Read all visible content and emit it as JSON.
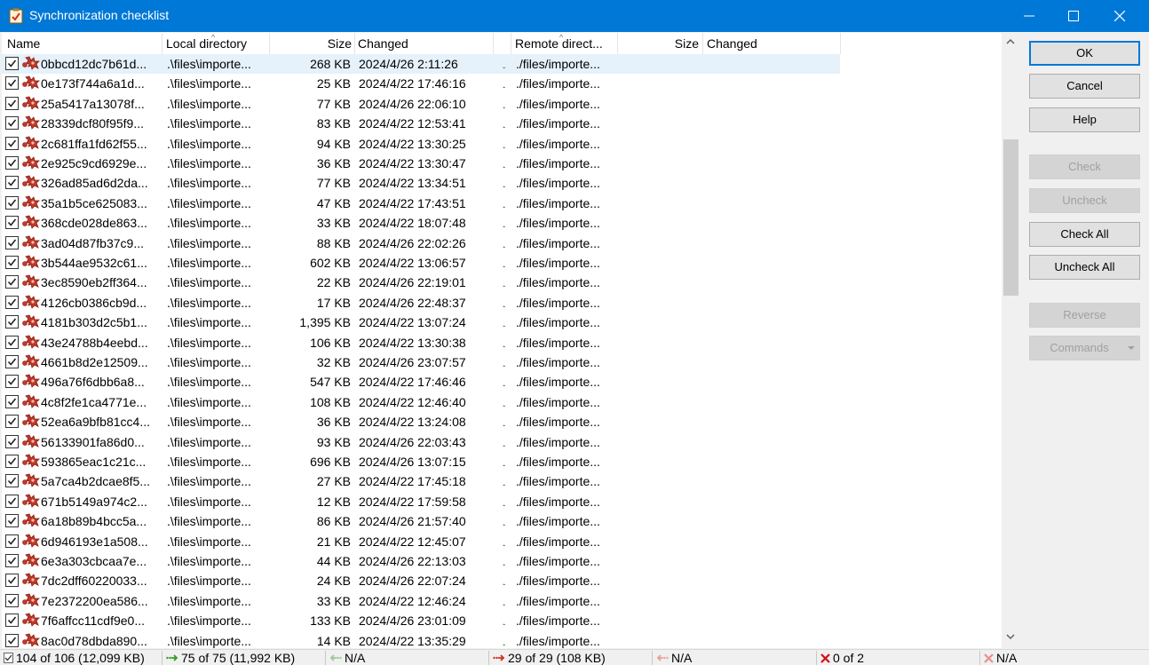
{
  "window": {
    "title": "Synchronization checklist",
    "icon": "checklist-icon"
  },
  "columns": {
    "name": "Name",
    "local_directory": "Local directory",
    "size": "Size",
    "changed": "Changed",
    "remote_directory": "Remote direct...",
    "remote_size": "Size",
    "remote_changed": "Changed"
  },
  "rows": [
    {
      "name": "0bbcd12dc7b61d...",
      "ldir": ".\\files\\importe...",
      "size": "268 KB",
      "changed": "2024/4/26 2:11:26",
      "rdir": "./files/importe..."
    },
    {
      "name": "0e173f744a6a1d...",
      "ldir": ".\\files\\importe...",
      "size": "25 KB",
      "changed": "2024/4/22 17:46:16",
      "rdir": "./files/importe..."
    },
    {
      "name": "25a5417a13078f...",
      "ldir": ".\\files\\importe...",
      "size": "77 KB",
      "changed": "2024/4/26 22:06:10",
      "rdir": "./files/importe..."
    },
    {
      "name": "28339dcf80f95f9...",
      "ldir": ".\\files\\importe...",
      "size": "83 KB",
      "changed": "2024/4/22 12:53:41",
      "rdir": "./files/importe..."
    },
    {
      "name": "2c681ffa1fd62f55...",
      "ldir": ".\\files\\importe...",
      "size": "94 KB",
      "changed": "2024/4/22 13:30:25",
      "rdir": "./files/importe..."
    },
    {
      "name": "2e925c9cd6929e...",
      "ldir": ".\\files\\importe...",
      "size": "36 KB",
      "changed": "2024/4/22 13:30:47",
      "rdir": "./files/importe..."
    },
    {
      "name": "326ad85ad6d2da...",
      "ldir": ".\\files\\importe...",
      "size": "77 KB",
      "changed": "2024/4/22 13:34:51",
      "rdir": "./files/importe..."
    },
    {
      "name": "35a1b5ce625083...",
      "ldir": ".\\files\\importe...",
      "size": "47 KB",
      "changed": "2024/4/22 17:43:51",
      "rdir": "./files/importe..."
    },
    {
      "name": "368cde028de863...",
      "ldir": ".\\files\\importe...",
      "size": "33 KB",
      "changed": "2024/4/22 18:07:48",
      "rdir": "./files/importe..."
    },
    {
      "name": "3ad04d87fb37c9...",
      "ldir": ".\\files\\importe...",
      "size": "88 KB",
      "changed": "2024/4/26 22:02:26",
      "rdir": "./files/importe..."
    },
    {
      "name": "3b544ae9532c61...",
      "ldir": ".\\files\\importe...",
      "size": "602 KB",
      "changed": "2024/4/22 13:06:57",
      "rdir": "./files/importe..."
    },
    {
      "name": "3ec8590eb2ff364...",
      "ldir": ".\\files\\importe...",
      "size": "22 KB",
      "changed": "2024/4/26 22:19:01",
      "rdir": "./files/importe..."
    },
    {
      "name": "4126cb0386cb9d...",
      "ldir": ".\\files\\importe...",
      "size": "17 KB",
      "changed": "2024/4/26 22:48:37",
      "rdir": "./files/importe..."
    },
    {
      "name": "4181b303d2c5b1...",
      "ldir": ".\\files\\importe...",
      "size": "1,395 KB",
      "changed": "2024/4/22 13:07:24",
      "rdir": "./files/importe..."
    },
    {
      "name": "43e24788b4eebd...",
      "ldir": ".\\files\\importe...",
      "size": "106 KB",
      "changed": "2024/4/22 13:30:38",
      "rdir": "./files/importe..."
    },
    {
      "name": "4661b8d2e12509...",
      "ldir": ".\\files\\importe...",
      "size": "32 KB",
      "changed": "2024/4/26 23:07:57",
      "rdir": "./files/importe..."
    },
    {
      "name": "496a76f6dbb6a8...",
      "ldir": ".\\files\\importe...",
      "size": "547 KB",
      "changed": "2024/4/22 17:46:46",
      "rdir": "./files/importe..."
    },
    {
      "name": "4c8f2fe1ca4771e...",
      "ldir": ".\\files\\importe...",
      "size": "108 KB",
      "changed": "2024/4/22 12:46:40",
      "rdir": "./files/importe..."
    },
    {
      "name": "52ea6a9bfb81cc4...",
      "ldir": ".\\files\\importe...",
      "size": "36 KB",
      "changed": "2024/4/22 13:24:08",
      "rdir": "./files/importe..."
    },
    {
      "name": "56133901fa86d0...",
      "ldir": ".\\files\\importe...",
      "size": "93 KB",
      "changed": "2024/4/26 22:03:43",
      "rdir": "./files/importe..."
    },
    {
      "name": "593865eac1c21c...",
      "ldir": ".\\files\\importe...",
      "size": "696 KB",
      "changed": "2024/4/26 13:07:15",
      "rdir": "./files/importe..."
    },
    {
      "name": "5a7ca4b2dcae8f5...",
      "ldir": ".\\files\\importe...",
      "size": "27 KB",
      "changed": "2024/4/22 17:45:18",
      "rdir": "./files/importe..."
    },
    {
      "name": "671b5149a974c2...",
      "ldir": ".\\files\\importe...",
      "size": "12 KB",
      "changed": "2024/4/22 17:59:58",
      "rdir": "./files/importe..."
    },
    {
      "name": "6a18b89b4bcc5a...",
      "ldir": ".\\files\\importe...",
      "size": "86 KB",
      "changed": "2024/4/26 21:57:40",
      "rdir": "./files/importe..."
    },
    {
      "name": "6d946193e1a508...",
      "ldir": ".\\files\\importe...",
      "size": "21 KB",
      "changed": "2024/4/22 12:45:07",
      "rdir": "./files/importe..."
    },
    {
      "name": "6e3a303cbcaa7e...",
      "ldir": ".\\files\\importe...",
      "size": "44 KB",
      "changed": "2024/4/26 22:13:03",
      "rdir": "./files/importe..."
    },
    {
      "name": "7dc2dff60220033...",
      "ldir": ".\\files\\importe...",
      "size": "24 KB",
      "changed": "2024/4/26 22:07:24",
      "rdir": "./files/importe..."
    },
    {
      "name": "7e2372200ea586...",
      "ldir": ".\\files\\importe...",
      "size": "33 KB",
      "changed": "2024/4/22 12:46:24",
      "rdir": "./files/importe..."
    },
    {
      "name": "7f6affcc11cdf9e0...",
      "ldir": ".\\files\\importe...",
      "size": "133 KB",
      "changed": "2024/4/26 23:01:09",
      "rdir": "./files/importe..."
    },
    {
      "name": "8ac0d78dbda890...",
      "ldir": ".\\files\\importe...",
      "size": "14 KB",
      "changed": "2024/4/22 13:35:29",
      "rdir": "./files/importe..."
    }
  ],
  "buttons": {
    "ok": "OK",
    "cancel": "Cancel",
    "help": "Help",
    "check": "Check",
    "uncheck": "Uncheck",
    "check_all": "Check All",
    "uncheck_all": "Uncheck All",
    "reverse": "Reverse",
    "commands": "Commands"
  },
  "status": {
    "total": "104 of 106 (12,099 KB)",
    "upload_new": "75 of 75 (11,992 KB)",
    "download_new": "N/A",
    "upload_update": "29 of 29 (108 KB)",
    "download_update": "N/A",
    "delete_remote": "0 of 2",
    "delete_local": "N/A"
  },
  "colors": {
    "titlebar": "#0078d7",
    "selected_row": "#e5f1fb",
    "upload_arrow": "#3a9a2a",
    "update_arrow": "#d03020",
    "delete": "#d01010"
  }
}
